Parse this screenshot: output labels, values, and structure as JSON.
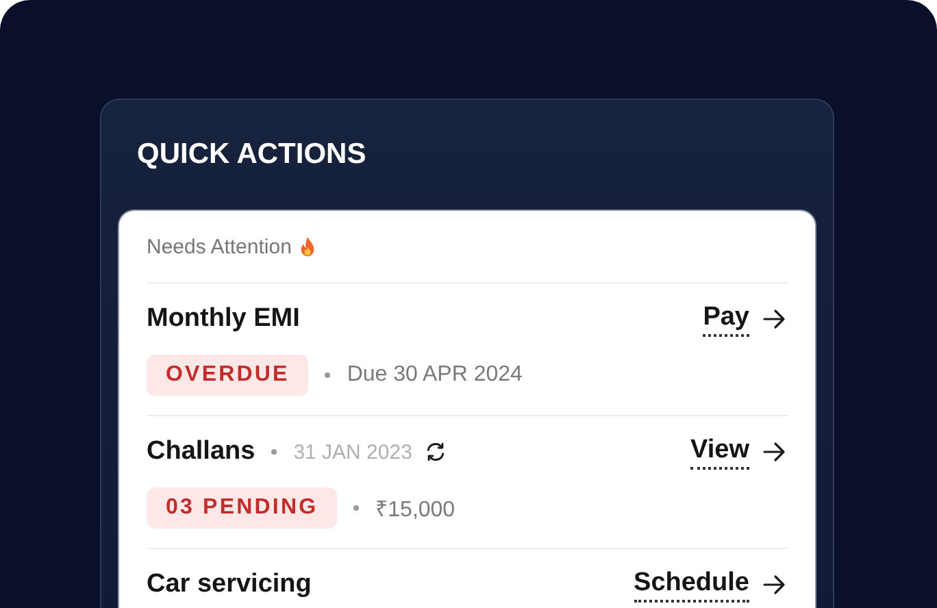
{
  "panel": {
    "title": "QUICK ACTIONS"
  },
  "section": {
    "label": "Needs Attention"
  },
  "items": [
    {
      "title": "Monthly EMI",
      "action": "Pay",
      "badge": "OVERDUE",
      "detail": "Due 30 APR 2024"
    },
    {
      "title": "Challans",
      "date": "31 JAN 2023",
      "refreshable": true,
      "action": "View",
      "badge": "03 PENDING",
      "detail": "₹15,000"
    },
    {
      "title": "Car servicing",
      "action": "Schedule"
    }
  ]
}
